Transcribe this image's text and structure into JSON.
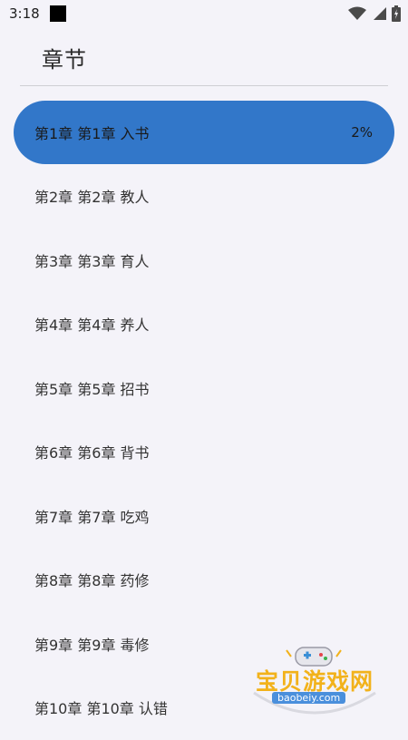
{
  "status": {
    "time": "3:18"
  },
  "header": {
    "title": "章节"
  },
  "chapters": [
    {
      "label": "第1章 第1章 入书",
      "progress": "2%",
      "active": true
    },
    {
      "label": "第2章 第2章 教人"
    },
    {
      "label": "第3章 第3章 育人"
    },
    {
      "label": "第4章 第4章 养人"
    },
    {
      "label": "第5章 第5章 招书"
    },
    {
      "label": "第6章 第6章 背书"
    },
    {
      "label": "第7章 第7章 吃鸡"
    },
    {
      "label": "第8章 第8章 药修"
    },
    {
      "label": "第9章 第9章 毒修"
    },
    {
      "label": "第10章 第10章 认错"
    }
  ],
  "watermark": {
    "text": "宝贝游戏网",
    "url": "baobeiy.com"
  },
  "colors": {
    "accent": "#3277c9",
    "background": "#f4f3f9"
  },
  "icons": [
    "wifi-icon",
    "signal-icon",
    "battery-icon",
    "gamepad-icon"
  ]
}
